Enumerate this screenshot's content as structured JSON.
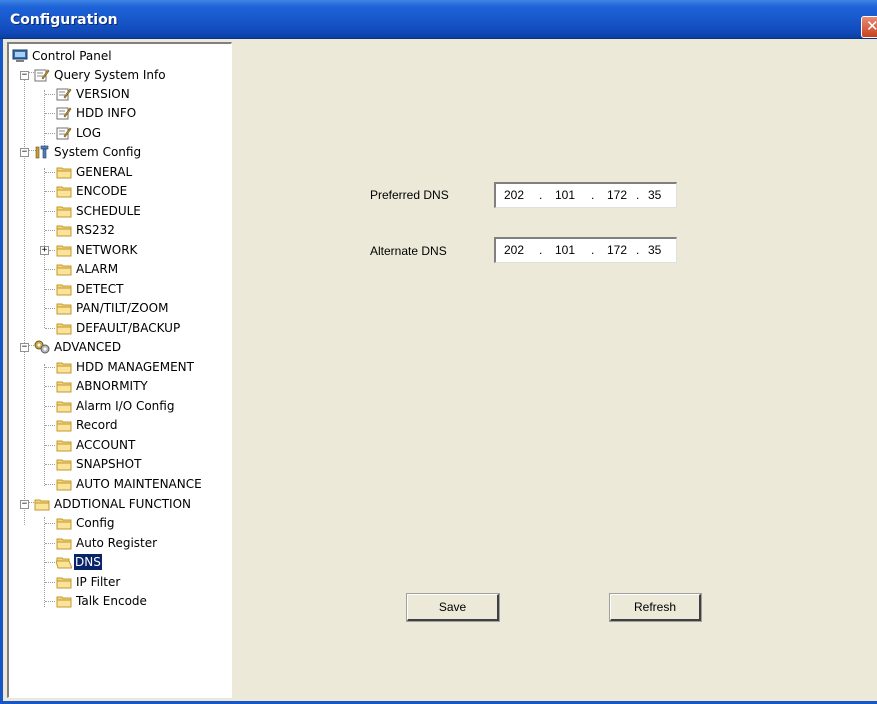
{
  "window": {
    "title": "Configuration",
    "close_glyph": "✕"
  },
  "tree": {
    "items": [
      {
        "label": "Control Panel",
        "icon": "monitor-icon"
      },
      {
        "label": "Query System Info",
        "icon": "edit-icon"
      },
      {
        "label": "VERSION",
        "icon": "edit-icon"
      },
      {
        "label": "HDD INFO",
        "icon": "edit-icon"
      },
      {
        "label": "LOG",
        "icon": "edit-icon"
      },
      {
        "label": "System Config",
        "icon": "tools-icon"
      },
      {
        "label": "GENERAL",
        "icon": "folder-icon"
      },
      {
        "label": "ENCODE",
        "icon": "folder-icon"
      },
      {
        "label": "SCHEDULE",
        "icon": "folder-icon"
      },
      {
        "label": "RS232",
        "icon": "folder-icon"
      },
      {
        "label": "NETWORK",
        "icon": "folder-icon"
      },
      {
        "label": "ALARM",
        "icon": "folder-icon"
      },
      {
        "label": "DETECT",
        "icon": "folder-icon"
      },
      {
        "label": "PAN/TILT/ZOOM",
        "icon": "folder-icon"
      },
      {
        "label": "DEFAULT/BACKUP",
        "icon": "folder-icon"
      },
      {
        "label": "ADVANCED",
        "icon": "gears-icon"
      },
      {
        "label": "HDD MANAGEMENT",
        "icon": "folder-icon"
      },
      {
        "label": "ABNORMITY",
        "icon": "folder-icon"
      },
      {
        "label": "Alarm I/O Config",
        "icon": "folder-icon"
      },
      {
        "label": "Record",
        "icon": "folder-icon"
      },
      {
        "label": "ACCOUNT",
        "icon": "folder-icon"
      },
      {
        "label": "SNAPSHOT",
        "icon": "folder-icon"
      },
      {
        "label": "AUTO MAINTENANCE",
        "icon": "folder-icon"
      },
      {
        "label": "ADDTIONAL FUNCTION",
        "icon": "folder-icon"
      },
      {
        "label": "Config",
        "icon": "folder-icon"
      },
      {
        "label": "Auto Register",
        "icon": "folder-icon"
      },
      {
        "label": "DNS",
        "icon": "folder-open-icon",
        "selected": true
      },
      {
        "label": "IP Filter",
        "icon": "folder-icon"
      },
      {
        "label": "Talk Encode",
        "icon": "folder-icon"
      }
    ]
  },
  "dns": {
    "preferred_label": "Preferred DNS",
    "preferred": [
      "202",
      "101",
      "172",
      "35"
    ],
    "alternate_label": "Alternate DNS",
    "alternate": [
      "202",
      "101",
      "172",
      "35"
    ],
    "separator": "."
  },
  "buttons": {
    "save": "Save",
    "refresh": "Refresh"
  },
  "colors": {
    "titlebar": "#1756C9",
    "selection": "#0A246A",
    "background": "#ECE9D8"
  }
}
